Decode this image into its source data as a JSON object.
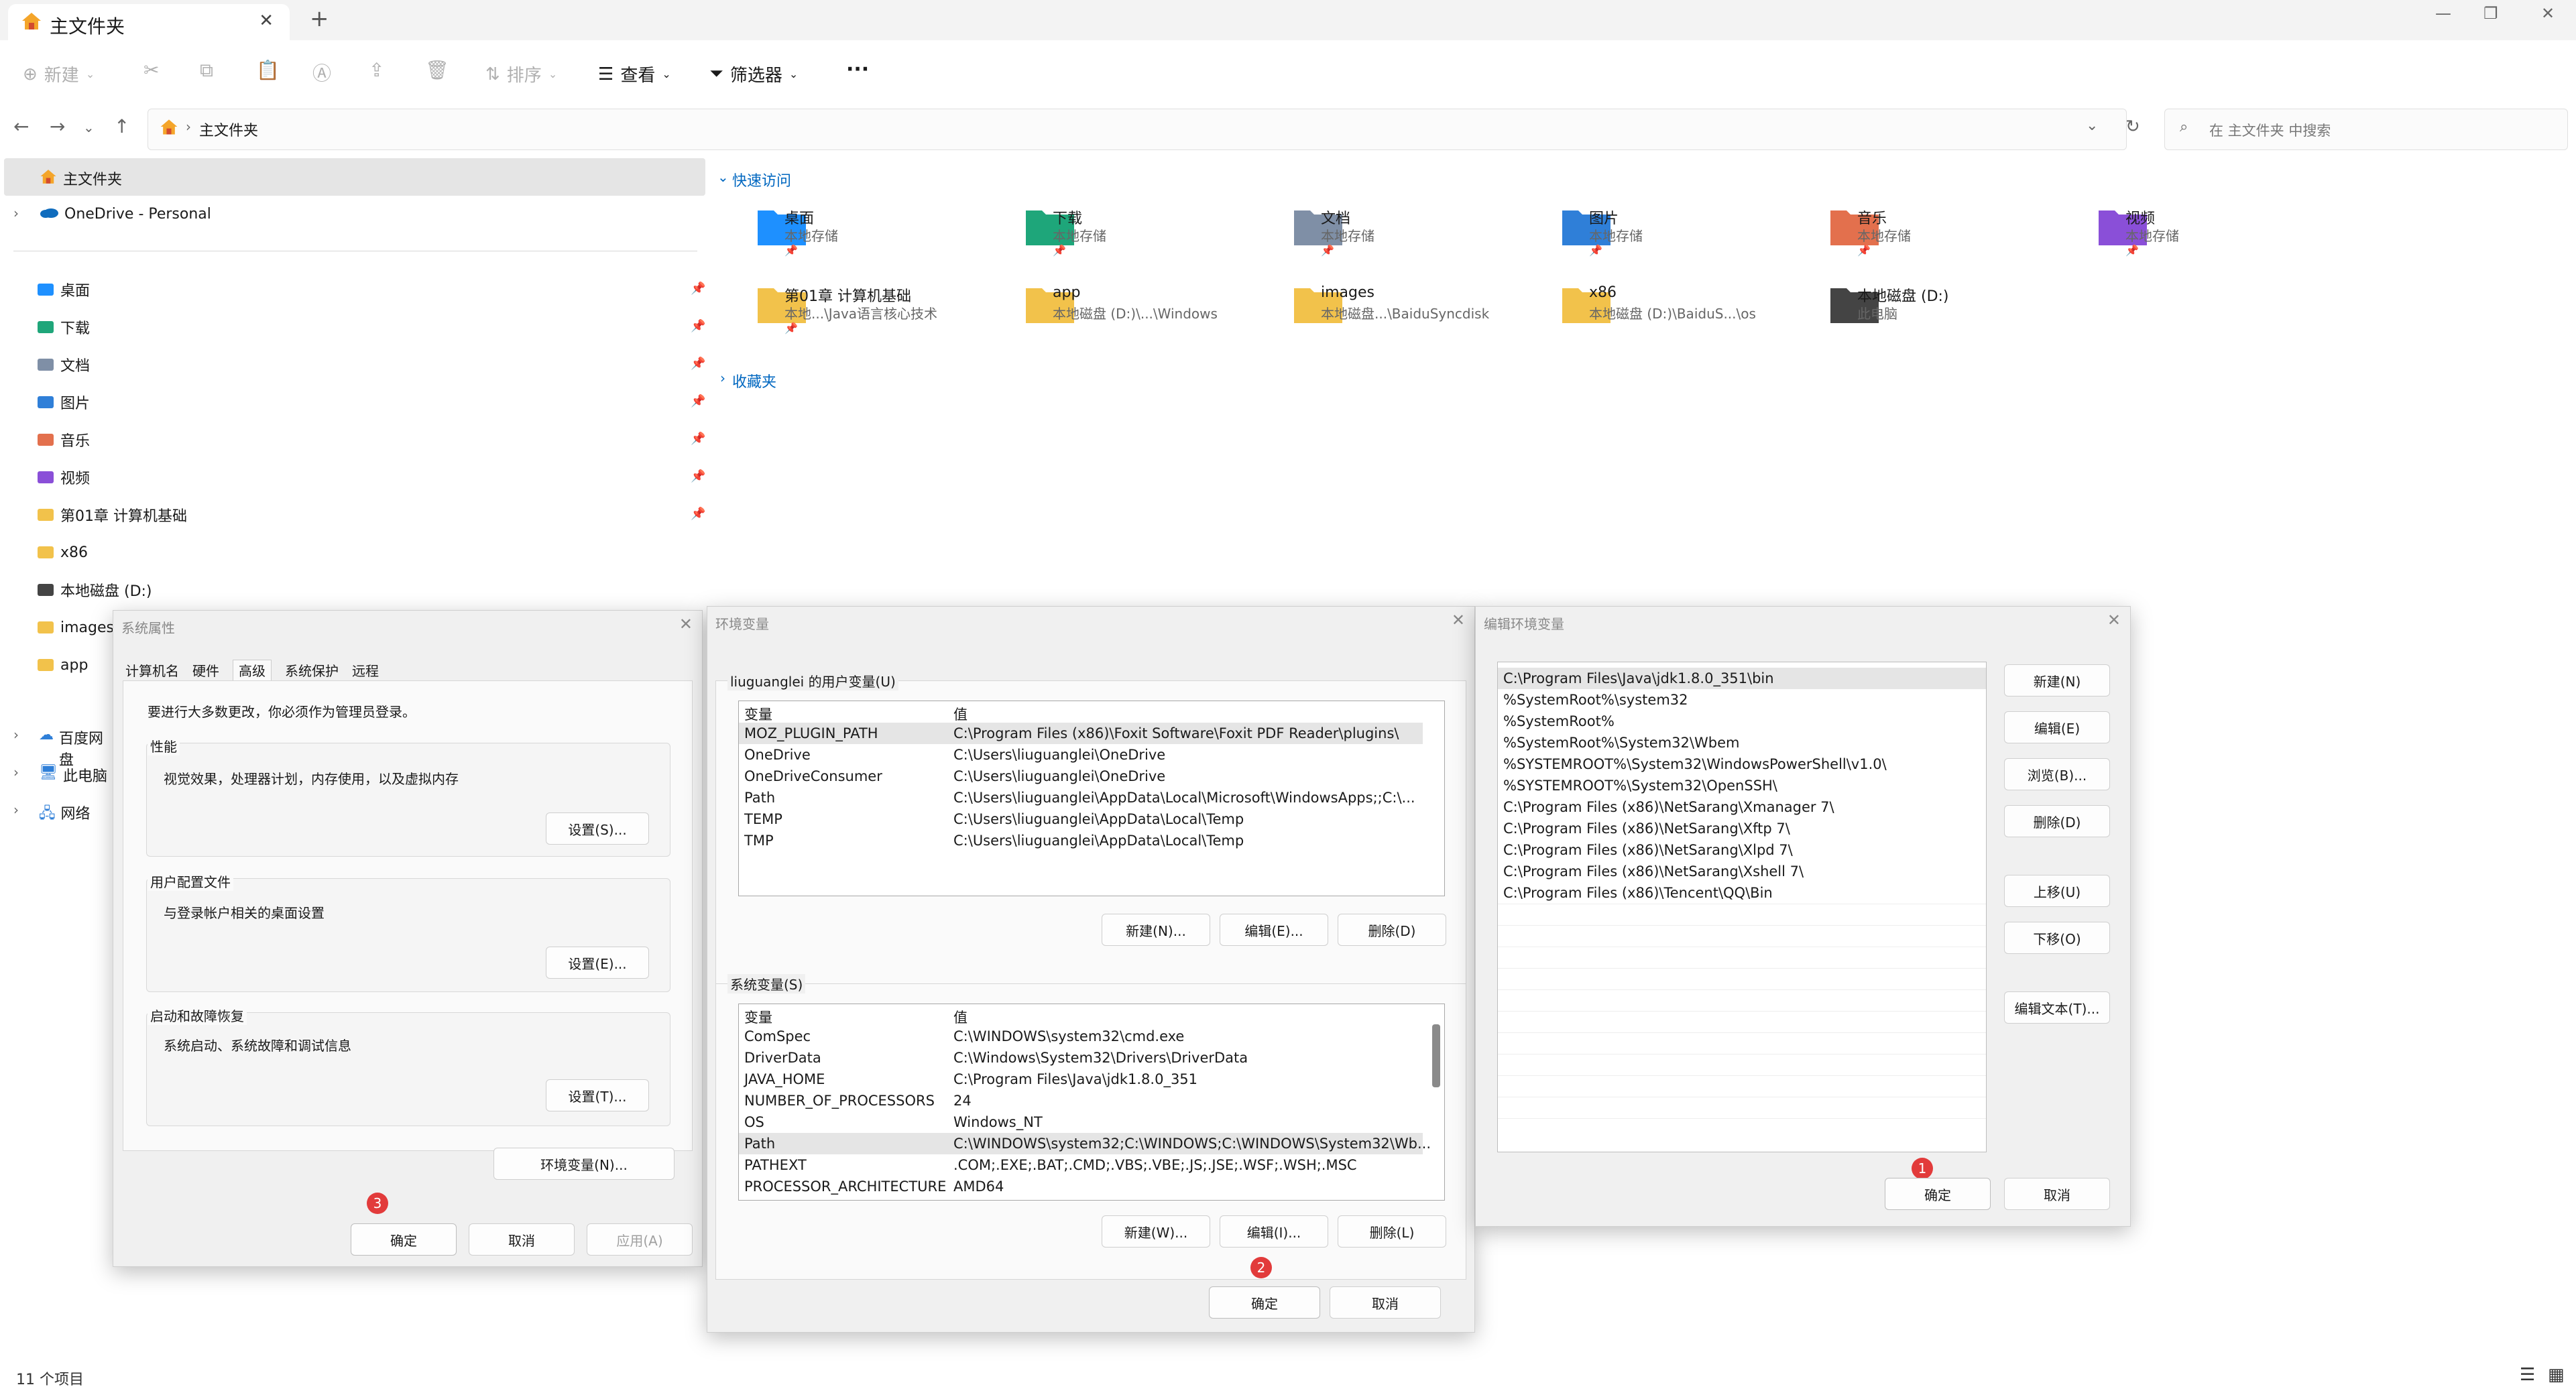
{
  "window": {
    "tab_title": "主文件夹",
    "new_tab": "+",
    "close_tab": "✕"
  },
  "command_bar": {
    "new": "新建",
    "sort": "排序",
    "view": "查看",
    "filter": "筛选器",
    "more": "···"
  },
  "address": {
    "path": "主文件夹",
    "search_placeholder": "在 主文件夹 中搜索"
  },
  "sidebar": {
    "home": "主文件夹",
    "onedrive": "OneDrive - Personal",
    "items": [
      {
        "label": "桌面",
        "pinned": true
      },
      {
        "label": "下载",
        "pinned": true
      },
      {
        "label": "文档",
        "pinned": true
      },
      {
        "label": "图片",
        "pinned": true
      },
      {
        "label": "音乐",
        "pinned": true
      },
      {
        "label": "视频",
        "pinned": true
      },
      {
        "label": "第01章 计算机基础",
        "pinned": true
      },
      {
        "label": "x86",
        "pinned": false
      },
      {
        "label": "本地磁盘 (D:)",
        "pinned": false
      },
      {
        "label": "images",
        "pinned": false
      },
      {
        "label": "app",
        "pinned": false
      }
    ],
    "bottom": [
      "百度网盘",
      "此电脑",
      "网络"
    ]
  },
  "quick_access": {
    "header": "快速访问",
    "favorites_header": "收藏夹",
    "tiles": [
      {
        "name": "桌面",
        "sub": "本地存储",
        "pin": true,
        "color": "#1e90ff"
      },
      {
        "name": "下载",
        "sub": "本地存储",
        "pin": true,
        "color": "#1fa67a"
      },
      {
        "name": "文档",
        "sub": "本地存储",
        "pin": true,
        "color": "#7f8fa6"
      },
      {
        "name": "图片",
        "sub": "本地存储",
        "pin": true,
        "color": "#2f7fd8"
      },
      {
        "name": "音乐",
        "sub": "本地存储",
        "pin": true,
        "color": "#e3704d"
      },
      {
        "name": "视频",
        "sub": "本地存储",
        "pin": true,
        "color": "#8a4fd8"
      },
      {
        "name": "第01章 计算机基础",
        "sub": "本地...\\Java语言核心技术",
        "pin": true,
        "color": "#f2c24b"
      },
      {
        "name": "app",
        "sub": "本地磁盘 (D:)\\...\\Windows",
        "pin": false,
        "color": "#f2c24b"
      },
      {
        "name": "images",
        "sub": "本地磁盘...\\BaiduSyncdisk",
        "pin": false,
        "color": "#f2c24b"
      },
      {
        "name": "x86",
        "sub": "本地磁盘 (D:)\\BaiduS...\\os",
        "pin": false,
        "color": "#f2c24b"
      },
      {
        "name": "本地磁盘 (D:)",
        "sub": "此电脑",
        "pin": false,
        "color": "#444444"
      }
    ]
  },
  "status": {
    "count": "11 个项目"
  },
  "sys_props": {
    "title": "系统属性",
    "tabs": [
      "计算机名",
      "硬件",
      "高级",
      "系统保护",
      "远程"
    ],
    "admin_note": "要进行大多数更改，你必须作为管理员登录。",
    "perf_label": "性能",
    "perf_text": "视觉效果，处理器计划，内存使用，以及虚拟内存",
    "perf_btn": "设置(S)...",
    "profile_label": "用户配置文件",
    "profile_text": "与登录帐户相关的桌面设置",
    "profile_btn": "设置(E)...",
    "startup_label": "启动和故障恢复",
    "startup_text": "系统启动、系统故障和调试信息",
    "startup_btn": "设置(T)...",
    "env_btn": "环境变量(N)...",
    "ok": "确定",
    "cancel": "取消",
    "apply": "应用(A)",
    "badge": "3"
  },
  "env_vars": {
    "title": "环境变量",
    "user_label": "liuguanglei 的用户变量(U)",
    "col_var": "变量",
    "col_val": "值",
    "user_rows": [
      [
        "MOZ_PLUGIN_PATH",
        "C:\\Program Files (x86)\\Foxit Software\\Foxit PDF Reader\\plugins\\"
      ],
      [
        "OneDrive",
        "C:\\Users\\liuguanglei\\OneDrive"
      ],
      [
        "OneDriveConsumer",
        "C:\\Users\\liuguanglei\\OneDrive"
      ],
      [
        "Path",
        "C:\\Users\\liuguanglei\\AppData\\Local\\Microsoft\\WindowsApps;;C:\\..."
      ],
      [
        "TEMP",
        "C:\\Users\\liuguanglei\\AppData\\Local\\Temp"
      ],
      [
        "TMP",
        "C:\\Users\\liuguanglei\\AppData\\Local\\Temp"
      ]
    ],
    "user_new": "新建(N)...",
    "user_edit": "编辑(E)...",
    "user_delete": "删除(D)",
    "sys_label": "系统变量(S)",
    "sys_rows": [
      [
        "ComSpec",
        "C:\\WINDOWS\\system32\\cmd.exe"
      ],
      [
        "DriverData",
        "C:\\Windows\\System32\\Drivers\\DriverData"
      ],
      [
        "JAVA_HOME",
        "C:\\Program Files\\Java\\jdk1.8.0_351"
      ],
      [
        "NUMBER_OF_PROCESSORS",
        "24"
      ],
      [
        "OS",
        "Windows_NT"
      ],
      [
        "Path",
        "C:\\WINDOWS\\system32;C:\\WINDOWS;C:\\WINDOWS\\System32\\Wb..."
      ],
      [
        "PATHEXT",
        ".COM;.EXE;.BAT;.CMD;.VBS;.VBE;.JS;.JSE;.WSF;.WSH;.MSC"
      ],
      [
        "PROCESSOR_ARCHITECTURE",
        "AMD64"
      ]
    ],
    "sys_new": "新建(W)...",
    "sys_edit": "编辑(I)...",
    "sys_delete": "删除(L)",
    "ok": "确定",
    "cancel": "取消",
    "badge": "2"
  },
  "edit_env": {
    "title": "编辑环境变量",
    "entries": [
      "C:\\Program Files\\Java\\jdk1.8.0_351\\bin",
      "%SystemRoot%\\system32",
      "%SystemRoot%",
      "%SystemRoot%\\System32\\Wbem",
      "%SYSTEMROOT%\\System32\\WindowsPowerShell\\v1.0\\",
      "%SYSTEMROOT%\\System32\\OpenSSH\\",
      "C:\\Program Files (x86)\\NetSarang\\Xmanager 7\\",
      "C:\\Program Files (x86)\\NetSarang\\Xftp 7\\",
      "C:\\Program Files (x86)\\NetSarang\\Xlpd 7\\",
      "C:\\Program Files (x86)\\NetSarang\\Xshell 7\\",
      "C:\\Program Files (x86)\\Tencent\\QQ\\Bin"
    ],
    "new": "新建(N)",
    "edit": "编辑(E)",
    "browse": "浏览(B)...",
    "delete": "删除(D)",
    "up": "上移(U)",
    "down": "下移(O)",
    "edit_text": "编辑文本(T)...",
    "ok": "确定",
    "cancel": "取消",
    "badge": "1"
  }
}
